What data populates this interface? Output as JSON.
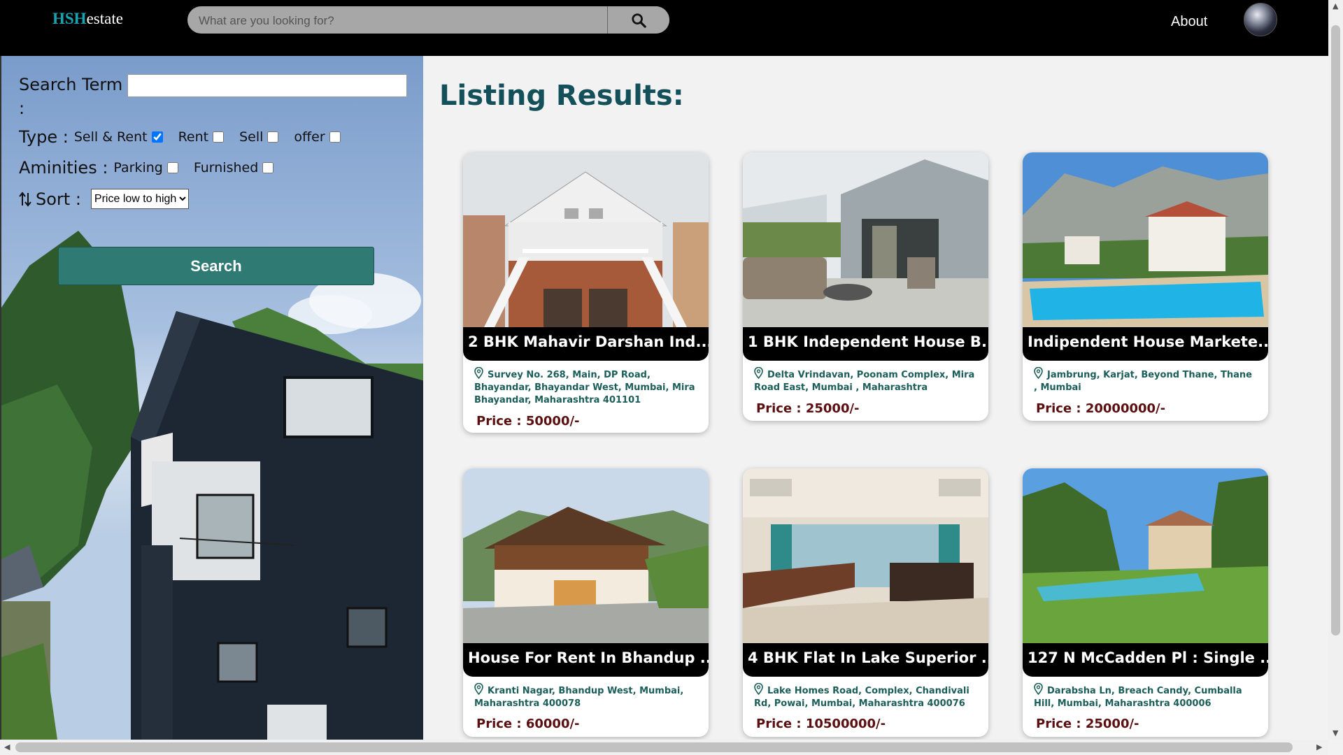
{
  "navbar": {
    "logo_brand": "HSH",
    "logo_suffix": "estate",
    "search_placeholder": "What are you looking for?",
    "about_label": "About"
  },
  "sidebar": {
    "search_term_label": "Search Term :",
    "type_label": "Type :",
    "type_options": [
      {
        "label": "Sell & Rent",
        "checked": true
      },
      {
        "label": "Rent",
        "checked": false
      },
      {
        "label": "Sell",
        "checked": false
      },
      {
        "label": "offer",
        "checked": false
      }
    ],
    "amenities_label": "Aminities :",
    "amenity_options": [
      {
        "label": "Parking",
        "checked": false
      },
      {
        "label": "Furnished",
        "checked": false
      }
    ],
    "sort_label": "Sort :",
    "sort_value": "Price low to high",
    "search_button": "Search"
  },
  "main": {
    "title": "Listing Results:",
    "listings": [
      {
        "title": "2 BHK Mahavir Darshan Ind...",
        "address": "Survey No. 268, Main, DP Road, Bhayandar, Bhayandar West, Mumbai, Mira Bhayandar, Maharashtra 401101",
        "price": "Price : 50000/-"
      },
      {
        "title": "1 BHK Independent House B...",
        "address": "Delta Vrindavan, Poonam Complex, Mira Road East, Mumbai , Maharashtra",
        "price": "Price : 25000/-"
      },
      {
        "title": "Indipendent House Markete...",
        "address": "Jambrung, Karjat, Beyond Thane, Thane , Mumbai",
        "price": "Price : 20000000/-"
      },
      {
        "title": "House For Rent In Bhandup ...",
        "address": "Kranti Nagar, Bhandup West, Mumbai, Maharashtra 400078",
        "price": "Price : 60000/-"
      },
      {
        "title": "4 BHK Flat In Lake Superior ...",
        "address": "Lake Homes Road, Complex, Chandivali Rd, Powai, Mumbai, Maharashtra 400076",
        "price": "Price : 10500000/-"
      },
      {
        "title": "127 N McCadden Pl : Single ...",
        "address": "Darabsha Ln, Breach Candy, Cumballa Hill, Mumbai, Maharashtra 400006",
        "price": "Price : 25000/-"
      }
    ]
  },
  "icons": {
    "search": "search-icon",
    "location": "location-pin-icon",
    "sort": "sort-arrows-icon"
  }
}
